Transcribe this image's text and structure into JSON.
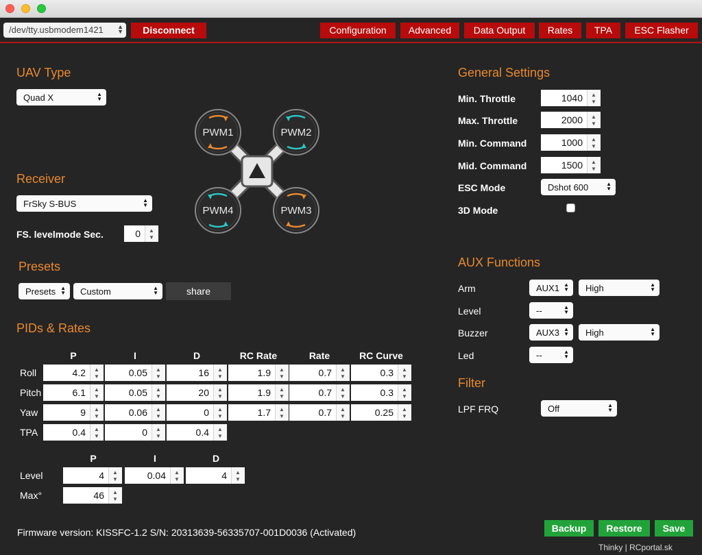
{
  "window": {
    "title": ""
  },
  "topbar": {
    "port": "/dev/tty.usbmodem1421",
    "disconnect": "Disconnect",
    "nav": [
      "Configuration",
      "Advanced",
      "Data Output",
      "Rates",
      "TPA",
      "ESC Flasher"
    ]
  },
  "uav": {
    "heading": "UAV Type",
    "type": "Quad X"
  },
  "motors": [
    "PWM1",
    "PWM2",
    "PWM3",
    "PWM4"
  ],
  "receiver": {
    "heading": "Receiver",
    "type": "FrSky S-BUS",
    "fs_label": "FS. levelmode Sec.",
    "fs_value": "0"
  },
  "presets": {
    "heading": "Presets",
    "preset": "Presets",
    "custom": "Custom",
    "share": "share"
  },
  "pids": {
    "heading": "PIDs & Rates",
    "columns": [
      "P",
      "I",
      "D",
      "RC Rate",
      "Rate",
      "RC Curve"
    ],
    "rows": [
      {
        "label": "Roll",
        "values": [
          "4.2",
          "0.05",
          "16",
          "1.9",
          "0.7",
          "0.3"
        ]
      },
      {
        "label": "Pitch",
        "values": [
          "6.1",
          "0.05",
          "20",
          "1.9",
          "0.7",
          "0.3"
        ]
      },
      {
        "label": "Yaw",
        "values": [
          "9",
          "0.06",
          "0",
          "1.7",
          "0.7",
          "0.25"
        ]
      },
      {
        "label": "TPA",
        "values": [
          "0.4",
          "0",
          "0.4"
        ]
      }
    ],
    "level_columns": [
      "P",
      "I",
      "D"
    ],
    "level": {
      "label": "Level",
      "values": [
        "4",
        "0.04",
        "4"
      ]
    },
    "max": {
      "label": "Max°",
      "value": "46"
    }
  },
  "general": {
    "heading": "General Settings",
    "min_throttle_label": "Min. Throttle",
    "min_throttle": "1040",
    "max_throttle_label": "Max. Throttle",
    "max_throttle": "2000",
    "min_command_label": "Min. Command",
    "min_command": "1000",
    "mid_command_label": "Mid. Command",
    "mid_command": "1500",
    "esc_mode_label": "ESC Mode",
    "esc_mode": "Dshot 600",
    "mode3d_label": "3D Mode"
  },
  "aux": {
    "heading": "AUX Functions",
    "items": [
      {
        "label": "Arm",
        "channel": "AUX1",
        "state": "High"
      },
      {
        "label": "Level",
        "channel": "--"
      },
      {
        "label": "Buzzer",
        "channel": "AUX3",
        "state": "High"
      },
      {
        "label": "Led",
        "channel": "--"
      }
    ]
  },
  "filter": {
    "heading": "Filter",
    "lpf_label": "LPF FRQ",
    "lpf": "Off"
  },
  "footer": {
    "firmware": "Firmware version: KISSFC-1.2 S/N: 20313639-56335707-001D0036 (Activated)",
    "backup": "Backup",
    "restore": "Restore",
    "save": "Save",
    "credit": "Thinky | RCportal.sk"
  },
  "colors": {
    "accent": "#e8892f",
    "danger": "#b80b0b",
    "success": "#22a33a",
    "background": "#252525"
  }
}
